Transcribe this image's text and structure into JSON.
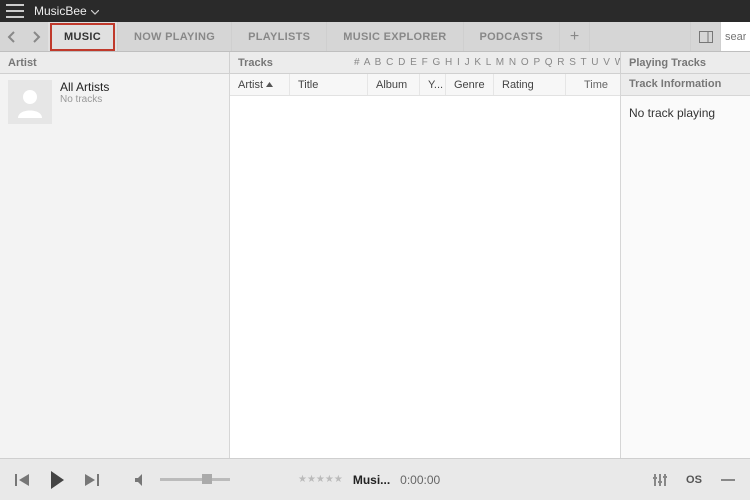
{
  "titlebar": {
    "app_name": "MusicBee"
  },
  "toolbar": {
    "tabs": [
      {
        "label": "MUSIC",
        "active": true,
        "highlight": true
      },
      {
        "label": "NOW PLAYING"
      },
      {
        "label": "PLAYLISTS"
      },
      {
        "label": "MUSIC EXPLORER"
      },
      {
        "label": "PODCASTS"
      }
    ],
    "search_placeholder": "search"
  },
  "columns": {
    "artist_header": "Artist",
    "tracks_header": "Tracks",
    "alpha_bar": "# A B C D E F G H I J K L M N O P Q R S T U V W X Y Z",
    "playing_header": "Playing Tracks"
  },
  "artists": {
    "all": {
      "name": "All Artists",
      "sub": "No tracks"
    }
  },
  "track_columns": {
    "artist": "Artist",
    "title": "Title",
    "album": "Album",
    "year": "Y...",
    "genre": "Genre",
    "rating": "Rating",
    "time": "Time"
  },
  "right": {
    "info_header": "Track Information",
    "no_track": "No track playing"
  },
  "player": {
    "now_playing_title": "Musi...",
    "time": "0:00:00",
    "lastfm_label": "OS"
  }
}
